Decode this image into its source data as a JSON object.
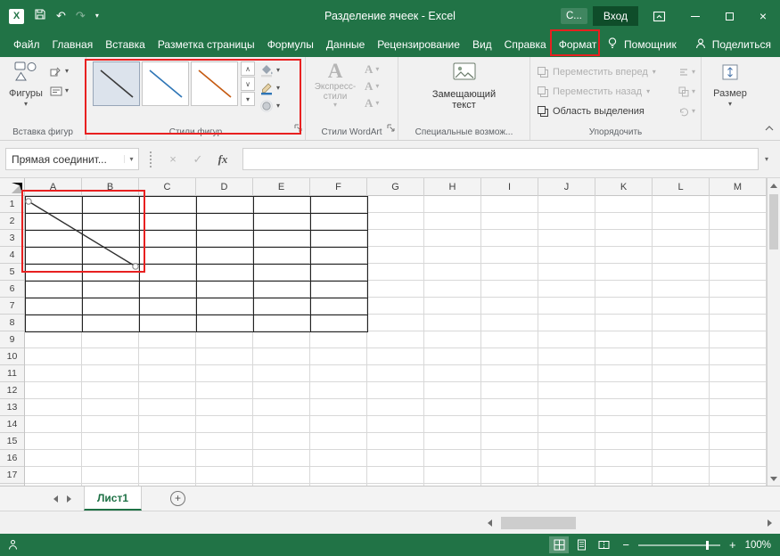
{
  "colors": {
    "excel_green": "#217346",
    "signin_green": "#0f4d2a",
    "annotation_red": "#e82020",
    "grid_line": "#d8d8d8",
    "table_border": "#222222"
  },
  "glyphs": {
    "caret": "▾",
    "up": "∧",
    "down": "∨",
    "plus": "+",
    "undo": "↶",
    "redo": "↷",
    "close": "×"
  },
  "titlebar": {
    "title": "Разделение ячеек - Excel",
    "account": "С...",
    "signin": "Вход"
  },
  "tabs": {
    "items": [
      {
        "label": "Файл",
        "name": "file"
      },
      {
        "label": "Главная",
        "name": "home"
      },
      {
        "label": "Вставка",
        "name": "insert"
      },
      {
        "label": "Разметка страницы",
        "name": "page-layout"
      },
      {
        "label": "Формулы",
        "name": "formulas"
      },
      {
        "label": "Данные",
        "name": "data"
      },
      {
        "label": "Рецензирование",
        "name": "review"
      },
      {
        "label": "Вид",
        "name": "view"
      },
      {
        "label": "Справка",
        "name": "help"
      },
      {
        "label": "Формат",
        "name": "format",
        "active": true,
        "annotated": true
      }
    ],
    "tellme": "Помощник",
    "share": "Поделиться"
  },
  "ribbon": {
    "insert_shapes": {
      "label": "Вставка фигур",
      "shapes_button": "Фигуры"
    },
    "shape_styles": {
      "label": "Стили фигур",
      "tiles": [
        {
          "name": "line-style-black",
          "color": "#3a3a3a",
          "selected": true
        },
        {
          "name": "line-style-blue",
          "color": "#2e75b6",
          "selected": false
        },
        {
          "name": "line-style-orange",
          "color": "#c55a11",
          "selected": false
        }
      ]
    },
    "wordart": {
      "label": "Стили WordArt",
      "quick_styles": "Экспресс-стили",
      "letter": "А"
    },
    "accessibility": {
      "label": "Специальные возмож...",
      "alt_text": "Замещающий текст"
    },
    "arrange": {
      "label": "Упорядочить",
      "items": [
        {
          "label": "Переместить вперед",
          "name": "bring-forward",
          "enabled": false,
          "caret": true
        },
        {
          "label": "Переместить назад",
          "name": "send-backward",
          "enabled": false,
          "caret": true
        },
        {
          "label": "Область выделения",
          "name": "selection-pane",
          "enabled": true,
          "caret": false
        }
      ]
    },
    "size": {
      "label": "Размер"
    }
  },
  "formula_bar": {
    "name_box": "Прямая соединит...",
    "cancel": "×",
    "enter": "✓",
    "fx": "fx"
  },
  "grid": {
    "columns": [
      "A",
      "B",
      "C",
      "D",
      "E",
      "F",
      "G",
      "H",
      "I",
      "J",
      "K",
      "L",
      "M"
    ],
    "row_count": 17,
    "bordered_table": {
      "cols": 6,
      "rows": 8,
      "range": "A1:F8"
    },
    "shape": {
      "type": "straight-connector-line",
      "from": "A1",
      "to": "B4"
    }
  },
  "sheetbar": {
    "active_tab": "Лист1"
  },
  "statusbar": {
    "zoom_out": "−",
    "zoom_in": "+",
    "zoom": "100%"
  }
}
